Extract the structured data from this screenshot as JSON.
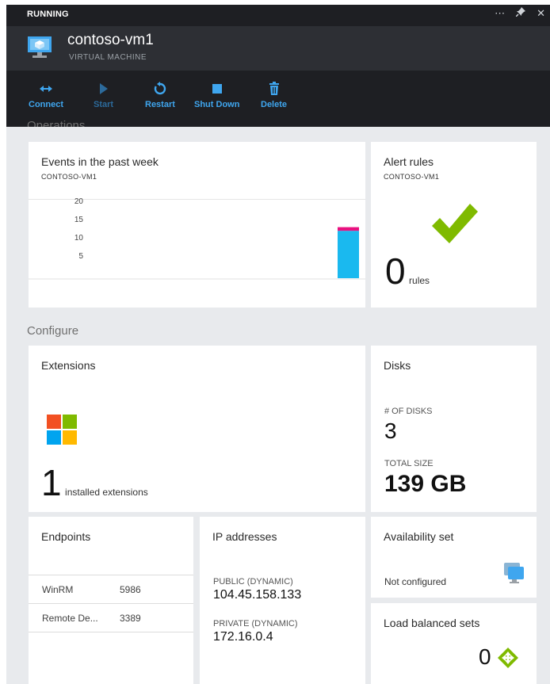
{
  "header": {
    "status": "RUNNING",
    "window_icons": [
      "more-icon",
      "pin-icon",
      "close-icon"
    ],
    "title": "contoso-vm1",
    "subtitle": "VIRTUAL MACHINE"
  },
  "commands": [
    {
      "label": "Connect",
      "icon": "connect-icon",
      "enabled": true
    },
    {
      "label": "Start",
      "icon": "play-icon",
      "enabled": false
    },
    {
      "label": "Restart",
      "icon": "restart-icon",
      "enabled": true
    },
    {
      "label": "Shut Down",
      "icon": "stop-icon",
      "enabled": true
    },
    {
      "label": "Delete",
      "icon": "trash-icon",
      "enabled": true
    }
  ],
  "sections": {
    "operations": "Operations",
    "configure": "Configure"
  },
  "events_tile": {
    "title": "Events in the past week",
    "subtitle": "CONTOSO-VM1",
    "y_ticks": [
      "20",
      "15",
      "10",
      "5"
    ]
  },
  "alert_tile": {
    "title": "Alert rules",
    "subtitle": "CONTOSO-VM1",
    "count": "0",
    "unit": "rules"
  },
  "extensions_tile": {
    "title": "Extensions",
    "count": "1",
    "unit": "installed extensions"
  },
  "disks_tile": {
    "title": "Disks",
    "count_label": "# OF DISKS",
    "count": "3",
    "size_label": "TOTAL SIZE",
    "size": "139 GB"
  },
  "endpoints_tile": {
    "title": "Endpoints",
    "rows": [
      {
        "name": "WinRM",
        "port": "5986"
      },
      {
        "name": "Remote De...",
        "port": "3389"
      }
    ]
  },
  "ip_tile": {
    "title": "IP addresses",
    "public_label": "PUBLIC (DYNAMIC)",
    "public_ip": "104.45.158.133",
    "private_label": "PRIVATE (DYNAMIC)",
    "private_ip": "172.16.0.4"
  },
  "availability_tile": {
    "title": "Availability set",
    "value": "Not configured"
  },
  "lb_tile": {
    "title": "Load balanced sets",
    "count": "0"
  },
  "chart_data": {
    "type": "bar",
    "title": "Events in the past week",
    "subtitle": "CONTOSO-VM1",
    "y_ticks": [
      20,
      15,
      10,
      5
    ],
    "ylim": [
      0,
      20
    ],
    "series": [
      {
        "color": "#1ab9ef",
        "values": [
          13
        ]
      },
      {
        "color": "#e8117f",
        "values": [
          1
        ]
      }
    ]
  },
  "colors": {
    "accent": "#3fa6ef",
    "header": "#1e1f23",
    "check": "#7fba00",
    "bar_info": "#1ab9ef",
    "bar_error": "#e8117f"
  }
}
